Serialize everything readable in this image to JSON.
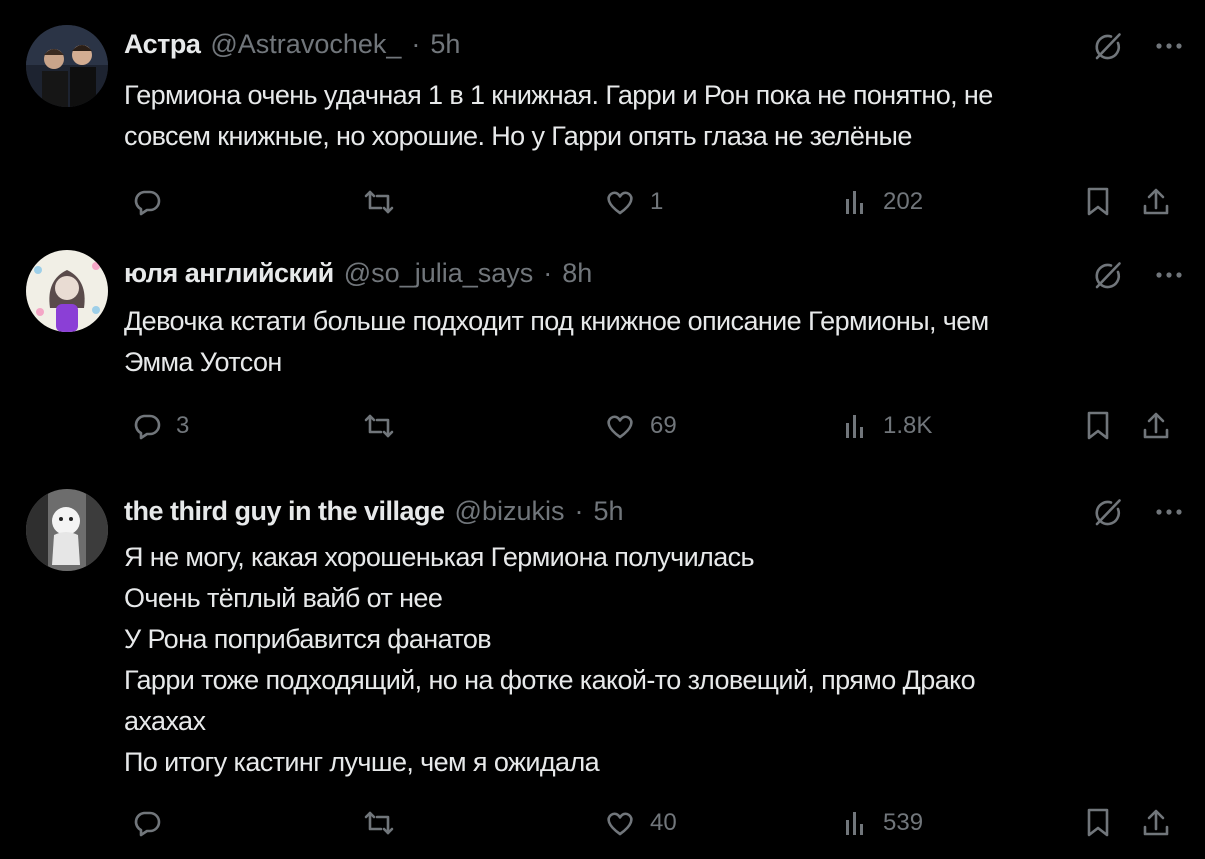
{
  "posts": [
    {
      "name": "Астра",
      "handle": "@Astravochek_",
      "dot": "·",
      "time": "5h",
      "lines": [
        "Гермиона очень удачная 1 в 1 книжная. Гарри и Рон пока не понятно, не",
        "совсем книжные, но хорошие. Но у Гарри опять глаза не зелёные"
      ],
      "replies": "",
      "reposts": "",
      "likes": "1",
      "views": "202"
    },
    {
      "name": "юля английский",
      "handle": "@so_julia_says",
      "dot": "·",
      "time": "8h",
      "lines": [
        "Девочка кстати больше подходит под книжное описание Гермионы, чем",
        "Эмма Уотсон"
      ],
      "replies": "3",
      "reposts": "",
      "likes": "69",
      "views": "1.8K"
    },
    {
      "name": "the third guy in the village",
      "handle": "@bizukis",
      "dot": "·",
      "time": "5h",
      "lines": [
        "Я не могу, какая хорошенькая Гермиона получилась",
        "Очень тёплый вайб от нее",
        "У Рона поприбавится фанатов",
        "Гарри тоже подходящий, но на фотке какой-то зловещий, прямо Драко",
        "ахахах",
        "По итогу кастинг лучше, чем я ожидала"
      ],
      "replies": "",
      "reposts": "",
      "likes": "40",
      "views": "539"
    }
  ],
  "icons": {
    "reply": "reply-icon",
    "repost": "repost-icon",
    "like": "heart-icon",
    "views": "views-icon",
    "bookmark": "bookmark-icon",
    "share": "share-icon",
    "grok": "grok-icon",
    "more": "more-icon"
  },
  "colors": {
    "background": "#000000",
    "text": "#e7e9ea",
    "muted": "#71767b"
  }
}
